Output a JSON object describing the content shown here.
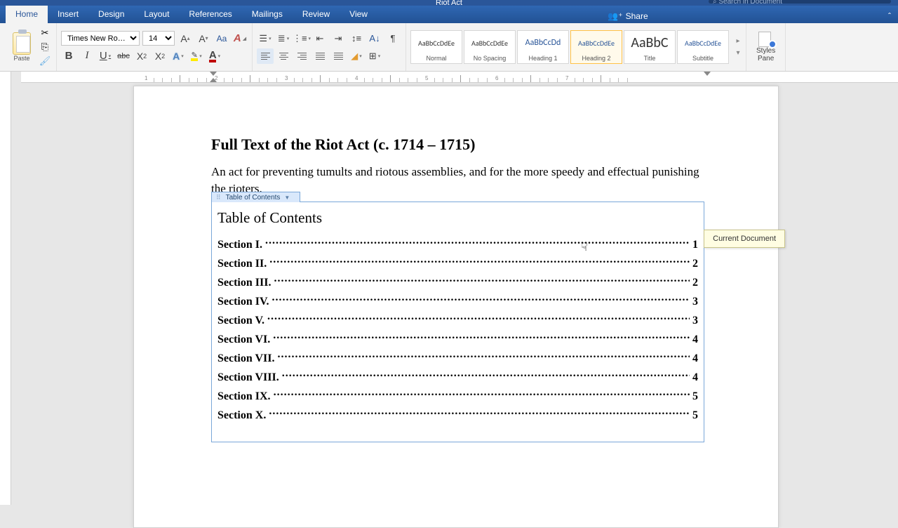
{
  "app": {
    "title": "Riot Act",
    "search_placeholder": "Search in Document"
  },
  "tabs": [
    "Home",
    "Insert",
    "Design",
    "Layout",
    "References",
    "Mailings",
    "Review",
    "View"
  ],
  "active_tab": 0,
  "share_label": "Share",
  "clipboard": {
    "paste_label": "Paste"
  },
  "font": {
    "name": "Times New Ro…",
    "size": "14",
    "btn_bold": "B",
    "btn_italic": "I",
    "btn_underline": "U",
    "btn_strike": "abc",
    "btn_sub_base": "X",
    "btn_sub_sub": "2",
    "btn_sup_base": "X",
    "btn_sup_sub": "2",
    "btn_A": "A",
    "btn_Aa": "Aa",
    "btn_clear": "A"
  },
  "style_tiles": [
    {
      "sample": "AaBbCcDdEe",
      "label": "Normal",
      "class": ""
    },
    {
      "sample": "AaBbCcDdEe",
      "label": "No Spacing",
      "class": ""
    },
    {
      "sample": "AaBbCcDd",
      "label": "Heading 1",
      "class": "h"
    },
    {
      "sample": "AaBbCcDdEe",
      "label": "Heading 2",
      "class": "h sel"
    },
    {
      "sample": "AaBbC",
      "label": "Title",
      "class": ""
    },
    {
      "sample": "AaBbCcDdEe",
      "label": "Subtitle",
      "class": "h"
    }
  ],
  "styles_pane": {
    "line1": "Styles",
    "line2": "Pane"
  },
  "document": {
    "heading": "Full Text of the Riot Act (c. 1714 – 1715)",
    "subtitle": "An act for preventing tumults and riotous assemblies, and for the more speedy and effectual punishing the rioters.",
    "toc_tab_label": "Table of Contents",
    "toc_heading": "Table of Contents",
    "toc": [
      {
        "label": "Section I.",
        "page": "1"
      },
      {
        "label": "Section II.",
        "page": "2"
      },
      {
        "label": "Section III.",
        "page": "2"
      },
      {
        "label": "Section IV.",
        "page": "3"
      },
      {
        "label": "Section V.",
        "page": "3"
      },
      {
        "label": "Section VI.",
        "page": "4"
      },
      {
        "label": "Section VII.",
        "page": "4"
      },
      {
        "label": "Section VIII.",
        "page": "4"
      },
      {
        "label": "Section IX.",
        "page": "5"
      },
      {
        "label": "Section X.",
        "page": "5"
      }
    ]
  },
  "tooltip": "Current Document",
  "ruler_numbers": [
    "1",
    "2",
    "3",
    "4",
    "5",
    "6",
    "7"
  ]
}
